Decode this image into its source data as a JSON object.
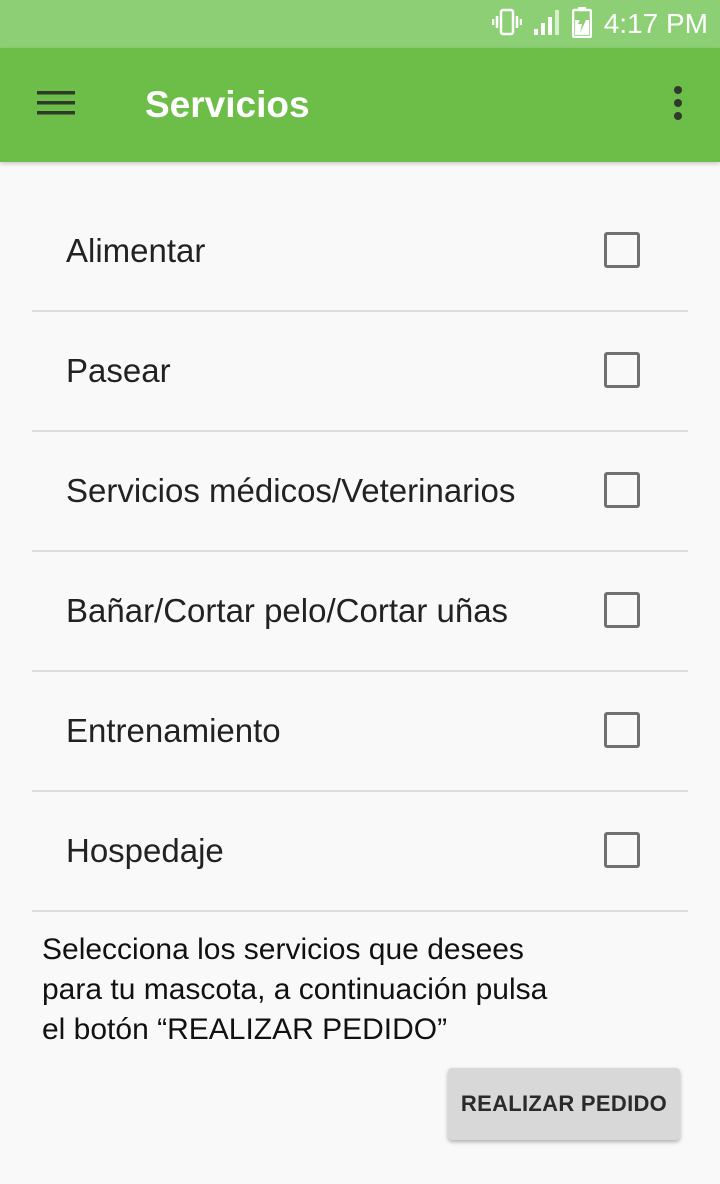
{
  "status_bar": {
    "time": "4:17 PM",
    "icons": [
      "vibrate-icon",
      "signal-icon",
      "battery-charging-icon"
    ]
  },
  "app_bar": {
    "title": "Servicios",
    "menu_icon": "hamburger-menu-icon",
    "overflow_icon": "more-vert-icon",
    "background_color": "#6cbe48"
  },
  "services": {
    "items": [
      {
        "label": "Alimentar",
        "checked": false
      },
      {
        "label": "Pasear",
        "checked": false
      },
      {
        "label": "Servicios médicos/Veterinarios",
        "checked": false
      },
      {
        "label": "Bañar/Cortar pelo/Cortar uñas",
        "checked": false
      },
      {
        "label": "Entrenamiento",
        "checked": false
      },
      {
        "label": "Hospedaje",
        "checked": false
      }
    ]
  },
  "instructions": {
    "line1": "Selecciona los servicios que desees",
    "line2": "para tu mascota, a continuación pulsa",
    "line3": "el botón “REALIZAR PEDIDO”"
  },
  "order_button": {
    "label": "REALIZAR PEDIDO"
  }
}
